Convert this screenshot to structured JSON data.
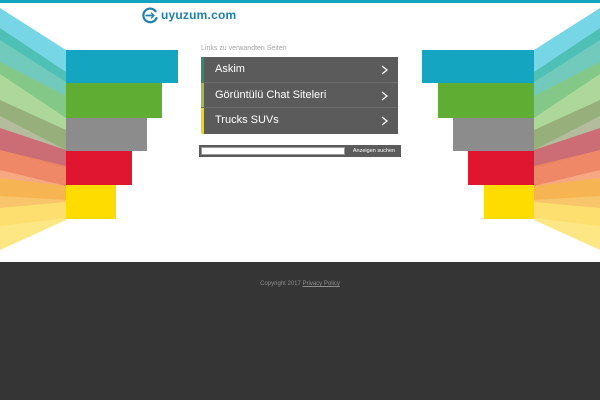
{
  "brand": {
    "name": "uyuzum.com",
    "color": "#1e7fb0"
  },
  "related": {
    "heading": "Links zu verwandten Seiten",
    "links": [
      {
        "label": "Askim",
        "accent": "#2d8f6f"
      },
      {
        "label": "Görüntülü Chat Siteleri",
        "accent": "#9ac13c"
      },
      {
        "label": "Trucks SUVs",
        "accent": "#f2d600"
      }
    ]
  },
  "search": {
    "value": "",
    "button_label": "Anzeigen suchen"
  },
  "footer": {
    "copyright": "Copyright 2017",
    "privacy_label": "Privacy Policy"
  },
  "colors": {
    "teal": "#14a5c1",
    "green": "#5fad32",
    "gray": "#8c8c8c",
    "red": "#e0152f",
    "yellow": "#fedc00",
    "link_bg": "#5b5b5b",
    "footer_bg": "#353535"
  }
}
